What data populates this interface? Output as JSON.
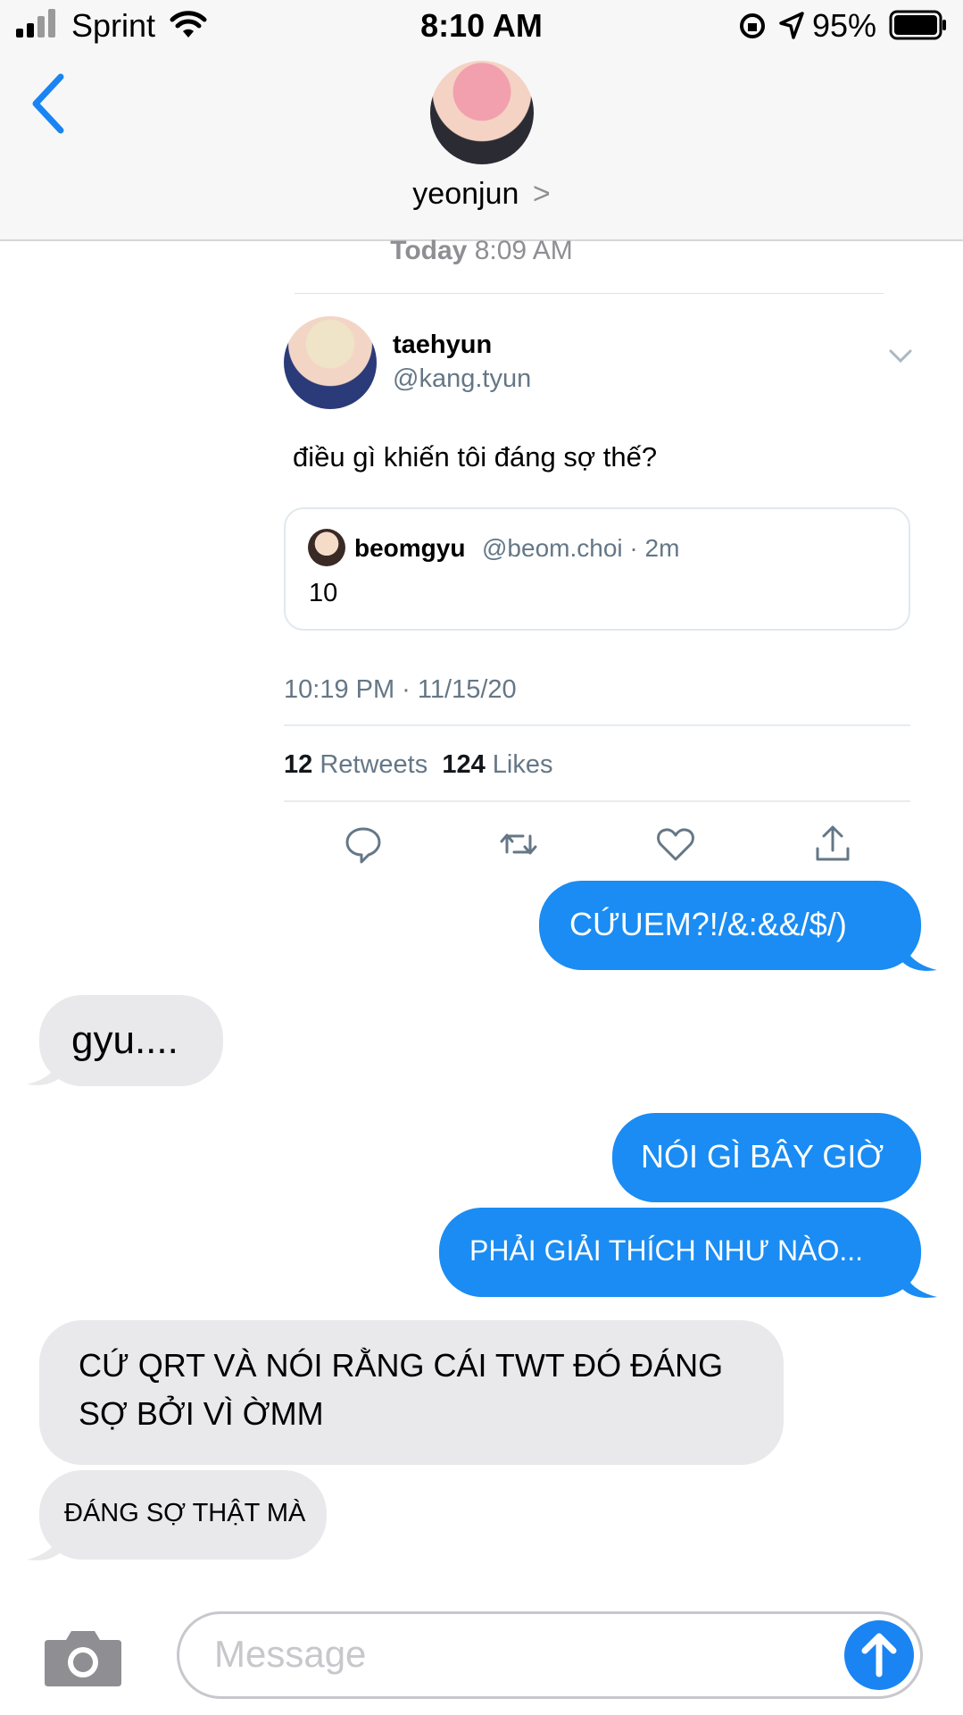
{
  "status_bar": {
    "carrier": "Sprint",
    "time": "8:10 AM",
    "battery": "95%"
  },
  "header": {
    "contact_name": "yeonjun",
    "contact_chevron": ">"
  },
  "tweet": {
    "sent_day": "Today",
    "sent_time": "8:09 AM",
    "author_name": "taehyun",
    "author_handle": "@kang.tyun",
    "text": "điều gì khiến tôi đáng sợ thế?",
    "quoted": {
      "name": "beomgyu",
      "meta": "@beom.choi · 2m",
      "text": "10"
    },
    "date": "10:19 PM · 11/15/20",
    "retweets_count": "12",
    "retweets_label": "Retweets",
    "likes_count": "124",
    "likes_label": "Likes"
  },
  "messages": [
    {
      "direction": "outgoing",
      "text": "CỨUEM?!/&:&&/$/)"
    },
    {
      "direction": "incoming",
      "text": "gyu...."
    },
    {
      "direction": "outgoing",
      "text": "NÓI GÌ BÂY GIỜ"
    },
    {
      "direction": "outgoing",
      "text": "PHẢI GIẢI THÍCH NHƯ NÀO..."
    },
    {
      "direction": "incoming",
      "text": "CỨ QRT VÀ NÓI RẰNG CÁI TWT ĐÓ ĐÁNG SỢ BỞI VÌ ỜMM"
    },
    {
      "direction": "incoming",
      "text": "ĐÁNG SỢ THẬT MÀ"
    }
  ],
  "composer": {
    "placeholder": "Message"
  },
  "colors": {
    "outgoing_bubble": "#1a8cf3",
    "incoming_bubble": "#e9e9eb",
    "accent": "#1a84f3"
  }
}
